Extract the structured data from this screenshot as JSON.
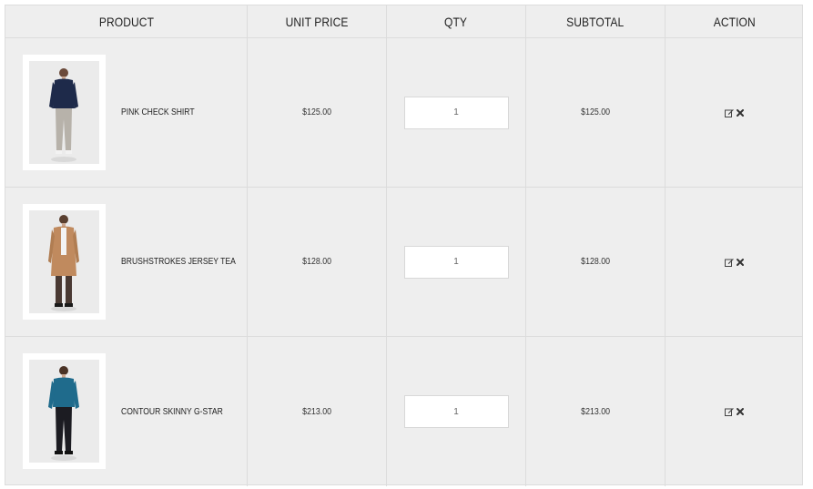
{
  "header": {
    "product": "PRODUCT",
    "unit_price": "UNIT PRICE",
    "qty": "QTY",
    "subtotal": "SUBTOTAL",
    "action": "ACTION"
  },
  "rows": [
    {
      "name": "PINK CHECK SHIRT",
      "unit_price": "$125.00",
      "qty": "1",
      "subtotal": "$125.00",
      "photo": "model-navy-shirt-grey-pants"
    },
    {
      "name": "BRUSHSTROKES JERSEY TEA",
      "unit_price": "$128.00",
      "qty": "1",
      "subtotal": "$128.00",
      "photo": "model-camel-coat"
    },
    {
      "name": "CONTOUR SKINNY G-STAR",
      "unit_price": "$213.00",
      "qty": "1",
      "subtotal": "$213.00",
      "photo": "model-teal-sweater-black-jeans"
    }
  ],
  "icons": {
    "edit": "edit-icon",
    "remove": "remove-icon"
  }
}
